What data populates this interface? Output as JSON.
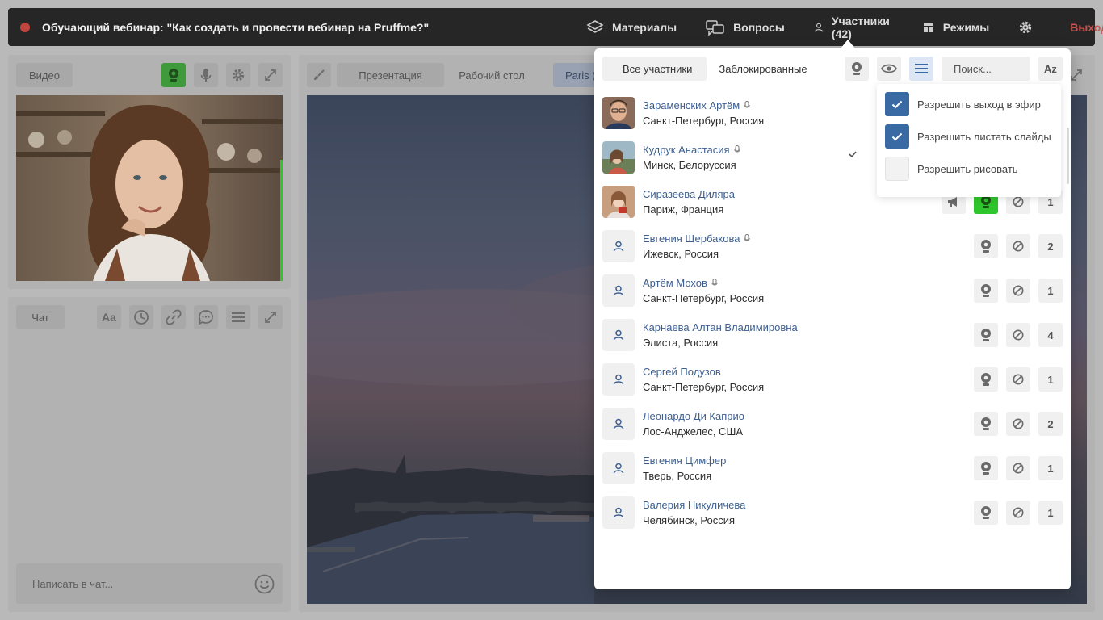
{
  "header": {
    "title": "Обучающий вебинар: \"Как создать и провести вебинар на Pruffme?\"",
    "nav": [
      {
        "label": "Материалы",
        "icon": "layers-icon"
      },
      {
        "label": "Вопросы",
        "icon": "questions-icon"
      },
      {
        "label": "Участники (42)",
        "icon": "user-icon"
      },
      {
        "label": "Режимы",
        "icon": "layout-icon"
      }
    ],
    "settings_icon": "gear-icon",
    "exit_label": "Выход",
    "exit_icon": "close-circle-icon"
  },
  "video_panel": {
    "label": "Видео"
  },
  "chat_panel": {
    "label": "Чат",
    "font_button": "Aa",
    "input_placeholder": "Написать в чат..."
  },
  "stage": {
    "tabs": [
      "Презентация",
      "Рабочий стол",
      "Paris ("
    ]
  },
  "participants": {
    "tabs": [
      "Все участники",
      "Заблокированные"
    ],
    "search_placeholder": "Поиск...",
    "sort_label": "Az",
    "items": [
      {
        "name": "Зараменских Артём",
        "city": "Санкт-Петербург, Россия",
        "mic": true,
        "photo": true,
        "count": ""
      },
      {
        "name": "Кудрук Анастасия",
        "city": "Минск, Белоруссия",
        "mic": true,
        "photo": true,
        "count": ""
      },
      {
        "name": "Сиразеева Диляра",
        "city": "Париж, Франция",
        "mic": false,
        "photo": true,
        "count": "1"
      },
      {
        "name": "Евгения Щербакова",
        "city": "Ижевск, Россия",
        "mic": true,
        "photo": false,
        "count": "2"
      },
      {
        "name": "Артём Мохов",
        "city": "Санкт-Петербург, Россия",
        "mic": true,
        "photo": false,
        "count": "1"
      },
      {
        "name": "Карнаева Алтан Владимировна",
        "city": "Элиста, Россия",
        "mic": false,
        "photo": false,
        "count": "4"
      },
      {
        "name": "Сергей Подузов",
        "city": "Санкт-Петербург, Россия",
        "mic": false,
        "photo": false,
        "count": "1"
      },
      {
        "name": "Леонардо Ди Каприо",
        "city": "Лос-Анджелес, США",
        "mic": false,
        "photo": false,
        "count": "2"
      },
      {
        "name": "Евгения Цимфер",
        "city": "Тверь, Россия",
        "mic": false,
        "photo": false,
        "count": "1"
      },
      {
        "name": "Валерия Никуличева",
        "city": "Челябинск, Россия",
        "mic": false,
        "photo": false,
        "count": "1"
      }
    ]
  },
  "permissions": [
    {
      "label": "Разрешить выход в эфир",
      "checked": true
    },
    {
      "label": "Разрешить листать слайды",
      "checked": true
    },
    {
      "label": "Разрешить рисовать",
      "checked": false
    }
  ],
  "colors": {
    "accent_blue": "#3a6aa4",
    "green": "#2fc52c",
    "exit_red": "#c65450"
  }
}
